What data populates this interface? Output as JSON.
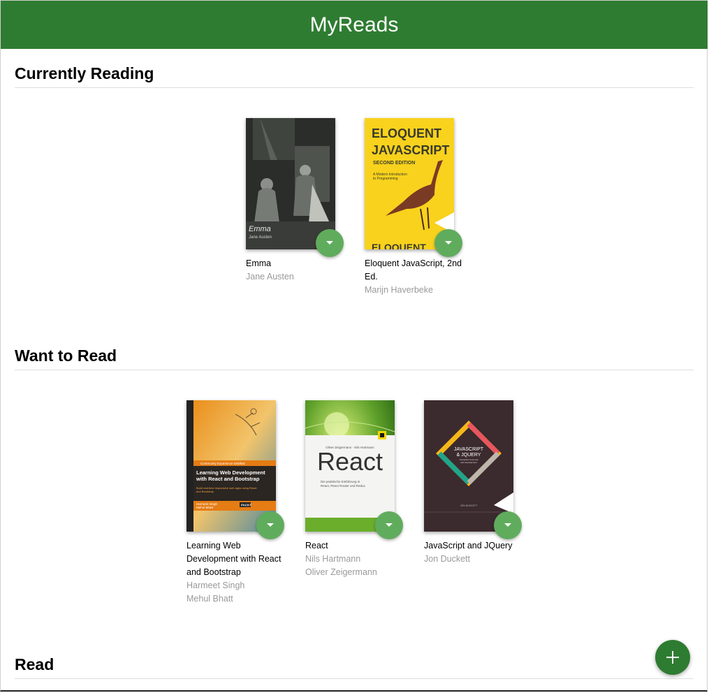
{
  "app": {
    "title": "MyReads"
  },
  "shelves": [
    {
      "title": "Currently Reading",
      "books": [
        {
          "title": "Emma",
          "authors": [
            "Jane Austen"
          ],
          "cover": {
            "title": "Emma",
            "author": "Jane Austen"
          }
        },
        {
          "title": "Eloquent JavaScript, 2nd Ed.",
          "authors": [
            "Marijn Haverbeke"
          ],
          "cover": {
            "line1": "ELOQUENT",
            "line2": "JAVASCRIPT",
            "edition": "SECOND EDITION",
            "subtitle1": "A Modern Introduction",
            "subtitle2": "to Programming",
            "bottom": "ELOQUENT"
          }
        }
      ]
    },
    {
      "title": "Want to Read",
      "books": [
        {
          "title": "Learning Web Development with React and Bootstrap",
          "authors": [
            "Harmeet Singh",
            "Mehul Bhatt"
          ],
          "cover": {
            "band": "Community Experience Distilled",
            "line1": "Learning Web Development",
            "line2": "with React and Bootstrap",
            "sub1": "Build real-time responsive web apps using React",
            "sub2": "and Bootstrap",
            "author1": "Harmeet Singh",
            "author2": "Mehul Bhatt",
            "publisher": "PACKT"
          }
        },
        {
          "title": "React",
          "authors": [
            "Nils Hartmann",
            "Oliver Zeigermann"
          ],
          "cover": {
            "authors": "Oliver Zeigermann · Nils Hartmann",
            "title": "React",
            "sub1": "Die praktische Einführung in",
            "sub2": "React, React Router und Redux"
          }
        },
        {
          "title": "JavaScript and JQuery",
          "authors": [
            "Jon Duckett"
          ],
          "cover": {
            "line1": "JAVASCRIPT",
            "line2": "& JQUERY",
            "sub1": "interactive front-end",
            "sub2": "web development",
            "author": "JON DUCKETT"
          }
        }
      ]
    },
    {
      "title": "Read",
      "books": []
    }
  ],
  "colors": {
    "header": "#2e7c31",
    "changer": "#60ac5d",
    "add_button": "#2e7c31",
    "author_text": "#999999"
  },
  "icons": {
    "changer": "triangle-down-icon",
    "add": "plus-icon"
  }
}
